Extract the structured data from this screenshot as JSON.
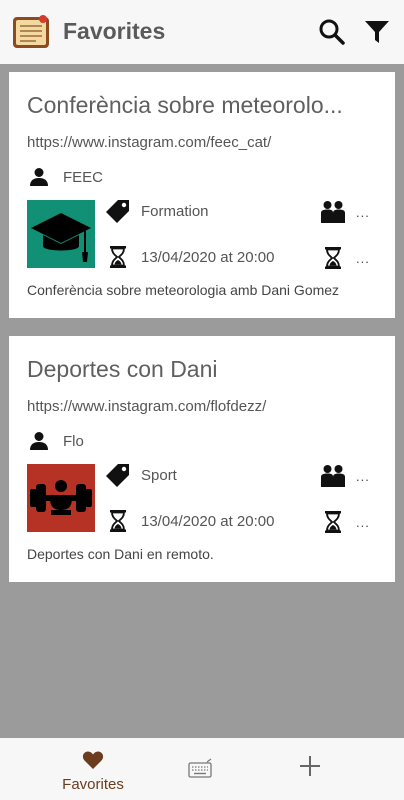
{
  "header": {
    "title": "Favorites",
    "logo_icon": "notebook-logo",
    "search_icon": "search-icon",
    "filter_icon": "filter-icon"
  },
  "cards": [
    {
      "title": "Conferència sobre meteorolo...",
      "url": "https://www.instagram.com/feec_cat/",
      "owner": "FEEC",
      "category": "Formation",
      "date": "13/04/2020 at 20:00",
      "participants": "...",
      "duration": "...",
      "description": "Conferència sobre meteorologia amb Dani Gomez",
      "thumb_icon": "graduation-cap-icon",
      "thumb_color": "#119075"
    },
    {
      "title": "Deportes con Dani",
      "url": "https://www.instagram.com/flofdezz/",
      "owner": "Flo",
      "category": "Sport",
      "date": "13/04/2020 at 20:00",
      "participants": "...",
      "duration": "...",
      "description": "Deportes con Dani en remoto.",
      "thumb_icon": "weightlifting-icon",
      "thumb_color": "#b63225"
    }
  ],
  "bottom_nav": {
    "favorites_label": "Favorites",
    "favorites_color": "#6b3c1e"
  }
}
